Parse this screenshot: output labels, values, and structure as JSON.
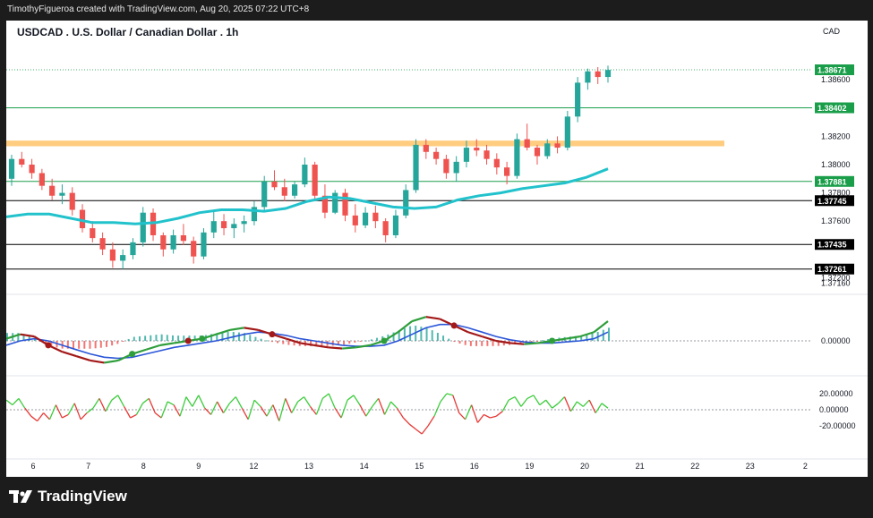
{
  "header": {
    "credit": "TimothyFigueroa created with TradingView.com, Aug 20, 2025 07:22 UTC+8"
  },
  "footer": {
    "brand": "TradingView"
  },
  "chart_data": {
    "type": "candlestick",
    "title": "USDCAD . U.S. Dollar / Canadian Dollar . 1h",
    "currency": "CAD",
    "x_ticks": [
      "6",
      "7",
      "8",
      "9",
      "12",
      "13",
      "14",
      "15",
      "16",
      "19",
      "20",
      "21",
      "22",
      "23",
      "2"
    ],
    "price_axis": {
      "ticks": [
        "1.38600",
        "1.38200",
        "1.38000",
        "1.37800",
        "1.37600",
        "1.37200",
        "1.37160"
      ],
      "ylim": [
        1.3712,
        1.3888
      ]
    },
    "price_labels": [
      {
        "value": "1.38671",
        "color": "#1a9e4a",
        "text_color": "#ffffff",
        "style": "dotted"
      },
      {
        "value": "1.38402",
        "color": "#1a9e4a",
        "text_color": "#ffffff",
        "style": "solid"
      },
      {
        "value": "1.37881",
        "color": "#1a9e4a",
        "text_color": "#ffffff",
        "style": "solid"
      },
      {
        "value": "1.37745",
        "color": "#000000",
        "text_color": "#ffffff",
        "style": "solid"
      },
      {
        "value": "1.37435",
        "color": "#000000",
        "text_color": "#ffffff",
        "style": "solid"
      },
      {
        "value": "1.37261",
        "color": "#000000",
        "text_color": "#ffffff",
        "style": "solid"
      }
    ],
    "resistance_zone": {
      "from": 1.3813,
      "to": 1.3817,
      "color": "#ffcc80"
    },
    "moving_average": {
      "color": "#22c2cc",
      "values": [
        1.3763,
        1.3765,
        1.3765,
        1.3762,
        1.3759,
        1.3759,
        1.3758,
        1.3759,
        1.3762,
        1.3766,
        1.3768,
        1.3768,
        1.3767,
        1.3769,
        1.3774,
        1.3777,
        1.3776,
        1.3773,
        1.377,
        1.3769,
        1.377,
        1.3775,
        1.3778,
        1.378,
        1.3783,
        1.3785,
        1.3787,
        1.3791,
        1.3797
      ]
    },
    "candles": [
      [
        1.379,
        1.3807,
        1.3785,
        1.3804
      ],
      [
        1.3804,
        1.3809,
        1.3798,
        1.38
      ],
      [
        1.38,
        1.3804,
        1.379,
        1.3794
      ],
      [
        1.3794,
        1.3797,
        1.3782,
        1.3785
      ],
      [
        1.3785,
        1.379,
        1.3775,
        1.3778
      ],
      [
        1.3778,
        1.3786,
        1.3772,
        1.378
      ],
      [
        1.378,
        1.3784,
        1.3764,
        1.3768
      ],
      [
        1.3768,
        1.3772,
        1.3752,
        1.3755
      ],
      [
        1.3755,
        1.376,
        1.3745,
        1.3748
      ],
      [
        1.3748,
        1.3752,
        1.3736,
        1.374
      ],
      [
        1.374,
        1.3745,
        1.3727,
        1.3732
      ],
      [
        1.3732,
        1.374,
        1.3726,
        1.3736
      ],
      [
        1.3736,
        1.3748,
        1.3733,
        1.3745
      ],
      [
        1.3745,
        1.377,
        1.3742,
        1.3766
      ],
      [
        1.3766,
        1.3769,
        1.3746,
        1.375
      ],
      [
        1.375,
        1.3752,
        1.3735,
        1.374
      ],
      [
        1.374,
        1.3754,
        1.3737,
        1.375
      ],
      [
        1.375,
        1.3758,
        1.3743,
        1.3746
      ],
      [
        1.3746,
        1.3749,
        1.373,
        1.3735
      ],
      [
        1.3735,
        1.3755,
        1.3733,
        1.3752
      ],
      [
        1.3752,
        1.3768,
        1.3748,
        1.376
      ],
      [
        1.376,
        1.3765,
        1.375,
        1.3755
      ],
      [
        1.3755,
        1.3762,
        1.3748,
        1.3758
      ],
      [
        1.3758,
        1.3764,
        1.3752,
        1.376
      ],
      [
        1.376,
        1.3774,
        1.3757,
        1.377
      ],
      [
        1.377,
        1.3792,
        1.3768,
        1.3788
      ],
      [
        1.3788,
        1.3796,
        1.3782,
        1.3784
      ],
      [
        1.3784,
        1.379,
        1.3774,
        1.3778
      ],
      [
        1.3778,
        1.3788,
        1.3776,
        1.3786
      ],
      [
        1.3786,
        1.3805,
        1.3784,
        1.38
      ],
      [
        1.38,
        1.3802,
        1.3774,
        1.3778
      ],
      [
        1.3778,
        1.3786,
        1.3762,
        1.3766
      ],
      [
        1.3766,
        1.3782,
        1.3765,
        1.378
      ],
      [
        1.378,
        1.3783,
        1.376,
        1.3764
      ],
      [
        1.3764,
        1.3772,
        1.3752,
        1.3757
      ],
      [
        1.3757,
        1.377,
        1.3755,
        1.3766
      ],
      [
        1.3766,
        1.3771,
        1.3755,
        1.376
      ],
      [
        1.376,
        1.3762,
        1.3745,
        1.375
      ],
      [
        1.375,
        1.3768,
        1.3748,
        1.3764
      ],
      [
        1.3764,
        1.3786,
        1.3762,
        1.3782
      ],
      [
        1.3782,
        1.3818,
        1.378,
        1.3814
      ],
      [
        1.3814,
        1.3818,
        1.3804,
        1.3809
      ],
      [
        1.3809,
        1.3812,
        1.38,
        1.3804
      ],
      [
        1.3804,
        1.3807,
        1.379,
        1.3794
      ],
      [
        1.3794,
        1.3806,
        1.3788,
        1.3802
      ],
      [
        1.3802,
        1.3817,
        1.3798,
        1.3812
      ],
      [
        1.3812,
        1.3818,
        1.3806,
        1.381
      ],
      [
        1.381,
        1.3814,
        1.38,
        1.3804
      ],
      [
        1.3804,
        1.3808,
        1.3793,
        1.3798
      ],
      [
        1.3798,
        1.3802,
        1.3786,
        1.3792
      ],
      [
        1.3792,
        1.3822,
        1.379,
        1.3818
      ],
      [
        1.3818,
        1.3829,
        1.381,
        1.3812
      ],
      [
        1.3812,
        1.3814,
        1.38,
        1.3806
      ],
      [
        1.3806,
        1.3818,
        1.3804,
        1.3815
      ],
      [
        1.3815,
        1.382,
        1.3808,
        1.3812
      ],
      [
        1.3812,
        1.3838,
        1.381,
        1.3834
      ],
      [
        1.3834,
        1.3862,
        1.383,
        1.3858
      ],
      [
        1.3858,
        1.3868,
        1.3853,
        1.3866
      ],
      [
        1.3866,
        1.3869,
        1.3857,
        1.3862
      ],
      [
        1.3862,
        1.387,
        1.3858,
        1.3867
      ]
    ],
    "macd_panel": {
      "zero_label": "0.00000",
      "macd_line": [
        2,
        6,
        4,
        -4,
        -10,
        -14,
        -18,
        -20,
        -18,
        -12,
        -8,
        -4,
        -2,
        0,
        2,
        6,
        10,
        12,
        10,
        6,
        2,
        -2,
        -4,
        -6,
        -7,
        -6,
        -4,
        0,
        8,
        18,
        22,
        20,
        14,
        8,
        4,
        0,
        -2,
        -3,
        -2,
        0,
        2,
        4,
        8,
        18
      ],
      "signal_line": [
        -4,
        0,
        2,
        0,
        -4,
        -8,
        -12,
        -15,
        -16,
        -15,
        -12,
        -9,
        -6,
        -4,
        -2,
        0,
        3,
        6,
        8,
        7,
        5,
        2,
        0,
        -2,
        -4,
        -5,
        -5,
        -4,
        0,
        6,
        12,
        15,
        15,
        12,
        8,
        4,
        1,
        -1,
        -2,
        -2,
        -1,
        0,
        2,
        8
      ],
      "line_colors": {
        "macd_rising": "#2e9e3a",
        "macd_falling": "#a31818",
        "signal": "#2a55d8"
      },
      "histogram_colors": {
        "positive": "#26a69a",
        "negative": "#ef5350"
      },
      "cross_markers": [
        {
          "index": 3,
          "color": "#a31818"
        },
        {
          "index": 9,
          "color": "#2e9e3a"
        },
        {
          "index": 13,
          "color": "#a31818"
        },
        {
          "index": 14,
          "color": "#2e9e3a"
        },
        {
          "index": 19,
          "color": "#a31818"
        },
        {
          "index": 27,
          "color": "#2e9e3a"
        },
        {
          "index": 32,
          "color": "#a31818"
        },
        {
          "index": 39,
          "color": "#2e9e3a"
        }
      ]
    },
    "oscillator_panel": {
      "ticks": [
        "20.00000",
        "0.00000",
        "-20.00000"
      ],
      "ylim": [
        -30,
        30
      ],
      "positive_color": "#3ccc3c",
      "negative_color": "#e53935",
      "values": [
        12,
        6,
        14,
        2,
        -8,
        -14,
        -4,
        -12,
        6,
        -10,
        -6,
        8,
        -12,
        -4,
        2,
        14,
        -2,
        12,
        18,
        4,
        -10,
        -6,
        8,
        14,
        -4,
        -10,
        10,
        6,
        -8,
        16,
        4,
        18,
        2,
        -6,
        10,
        -4,
        8,
        16,
        2,
        -12,
        12,
        4,
        -8,
        6,
        -14,
        14,
        -4,
        10,
        16,
        4,
        -6,
        14,
        20,
        2,
        -10,
        12,
        18,
        6,
        -8,
        4,
        14,
        -6,
        10,
        2,
        -10,
        -18,
        -24,
        -30,
        -20,
        -8,
        10,
        20,
        18,
        -4,
        -12,
        6,
        -16,
        -6,
        -10,
        -8,
        -2,
        12,
        16,
        4,
        14,
        18,
        6,
        12,
        2,
        8,
        16,
        -2,
        10,
        4,
        12,
        -4,
        8,
        2
      ]
    }
  }
}
